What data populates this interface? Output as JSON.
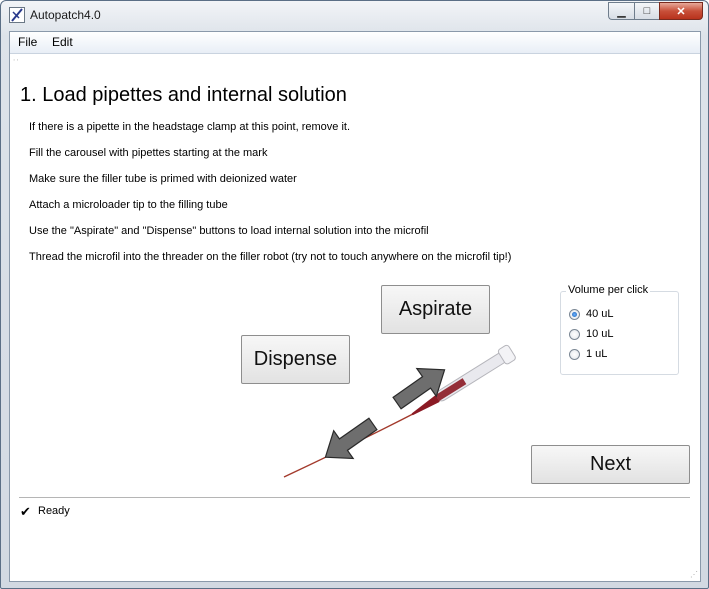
{
  "window": {
    "title": "Autopatch4.0",
    "minimize_glyph": "▁",
    "maximize_glyph": "□",
    "close_glyph": "✕"
  },
  "menu": {
    "file": "File",
    "edit": "Edit"
  },
  "main": {
    "heading": "1. Load pipettes and internal solution",
    "instructions": [
      "If there is a pipette in the headstage clamp at this point, remove it.",
      "Fill the carousel with pipettes starting at the mark",
      "Make sure the filler tube is primed with deionized water",
      "Attach a microloader tip to the filling tube",
      "Use the \"Aspirate\" and \"Dispense\" buttons to load internal solution into the microfil",
      "Thread the microfil into the threader on the filler robot (try not to touch anywhere on the microfil tip!)"
    ],
    "aspirate_label": "Aspirate",
    "dispense_label": "Dispense",
    "next_label": "Next"
  },
  "volume": {
    "title": "Volume per click",
    "options": [
      "40 uL",
      "10 uL",
      "1 uL"
    ],
    "selected": "40 uL"
  },
  "status": {
    "check_glyph": "✔",
    "text": "Ready"
  },
  "colors": {
    "arrow_fill": "#6e6e6e",
    "tubing": "#a33a2c",
    "radio_selected": "#1a5fb4"
  }
}
